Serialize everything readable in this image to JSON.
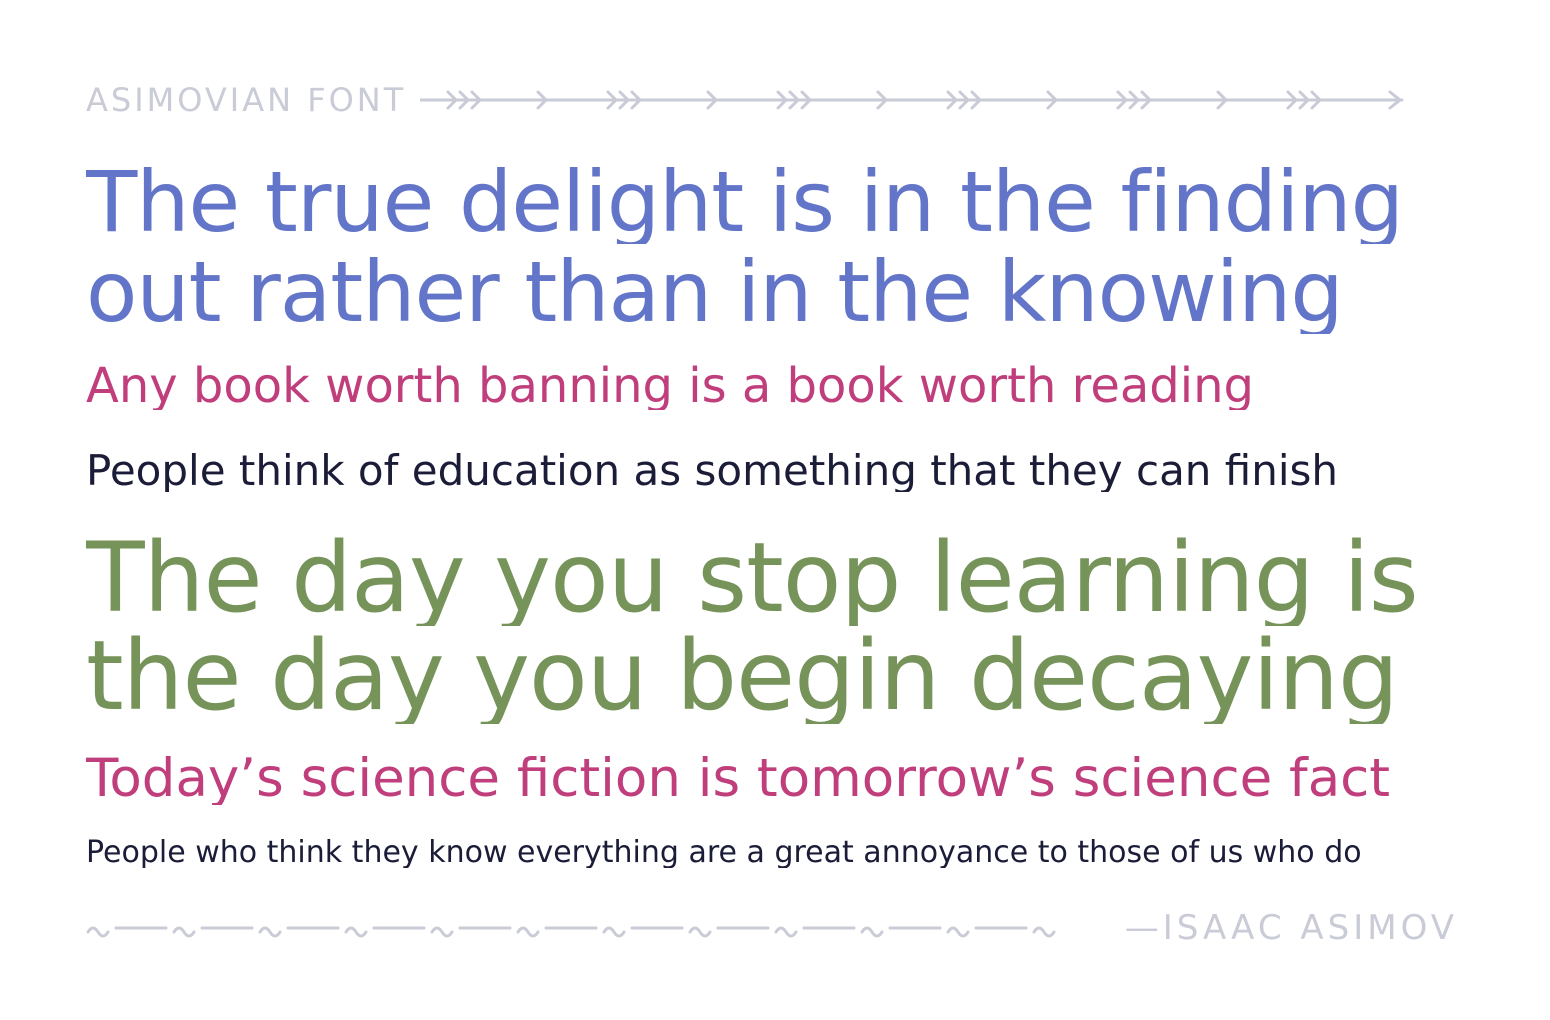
{
  "header": {
    "title": "ASIMOVIAN FONT",
    "ornament": "decorative-arrow-line"
  },
  "quotes": [
    {
      "line1": "The true delight is in the finding",
      "line2": "out rather than in the knowing",
      "color": "#6275c8"
    },
    {
      "line1": "Any book worth banning is a book worth reading",
      "color": "#c03e7b"
    },
    {
      "line1": "People think of education as something that they can finish",
      "color": "#1b1d38"
    },
    {
      "line1": "The day you stop learning is",
      "line2": "the day you begin decaying",
      "color": "#76935a"
    },
    {
      "line1": "Today’s science fiction is tomorrow’s science fact",
      "color": "#c03e7b"
    },
    {
      "line1": "People who think they know everything are a great annoyance to those of us who do",
      "color": "#1b1d38"
    }
  ],
  "footer": {
    "author": "—ISAAC ASIMOV",
    "ornament": "decorative-wave-line"
  },
  "colors": {
    "ornament": "#c9cbd6",
    "blue": "#6275c8",
    "magenta": "#c03e7b",
    "navy": "#1b1d38",
    "green": "#76935a"
  }
}
